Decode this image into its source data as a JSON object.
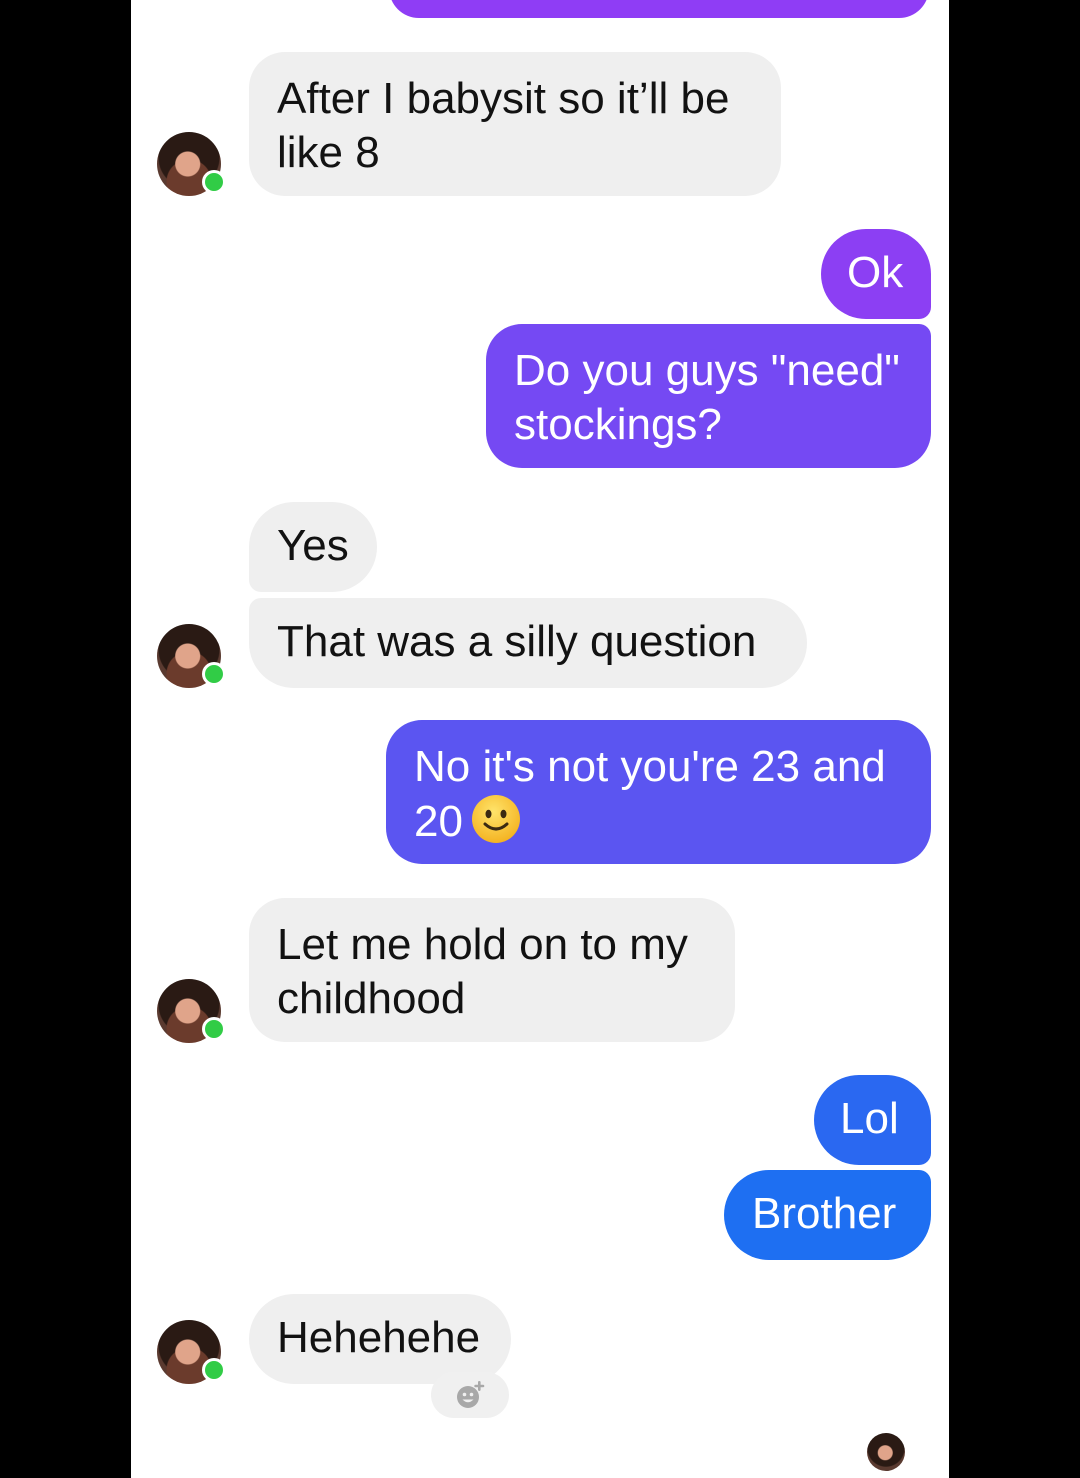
{
  "messages": {
    "m1": "After I babysit so it’ll be",
    "m1b": "like 8",
    "m2": "Ok",
    "m3a": "Do you guys \"need\"",
    "m3b": "stockings?",
    "m4": "Yes",
    "m5": "That was a silly question",
    "m6a": "No it's not you're 23 and",
    "m6b": "20",
    "m7a": "Let me hold on to my",
    "m7b": "childhood",
    "m8": "Lol",
    "m9": "Brother",
    "m10": "Hehehehe"
  },
  "icons": {
    "emoji": "slightly-smiling-face",
    "react": "add-reaction-icon",
    "online": "online-status-dot"
  },
  "colors": {
    "incoming": "#efefef",
    "outgoing_purple": "#8c3ff3",
    "outgoing_indigo": "#5b55f1",
    "outgoing_blue": "#1e6ff2",
    "online": "#31cc46"
  }
}
